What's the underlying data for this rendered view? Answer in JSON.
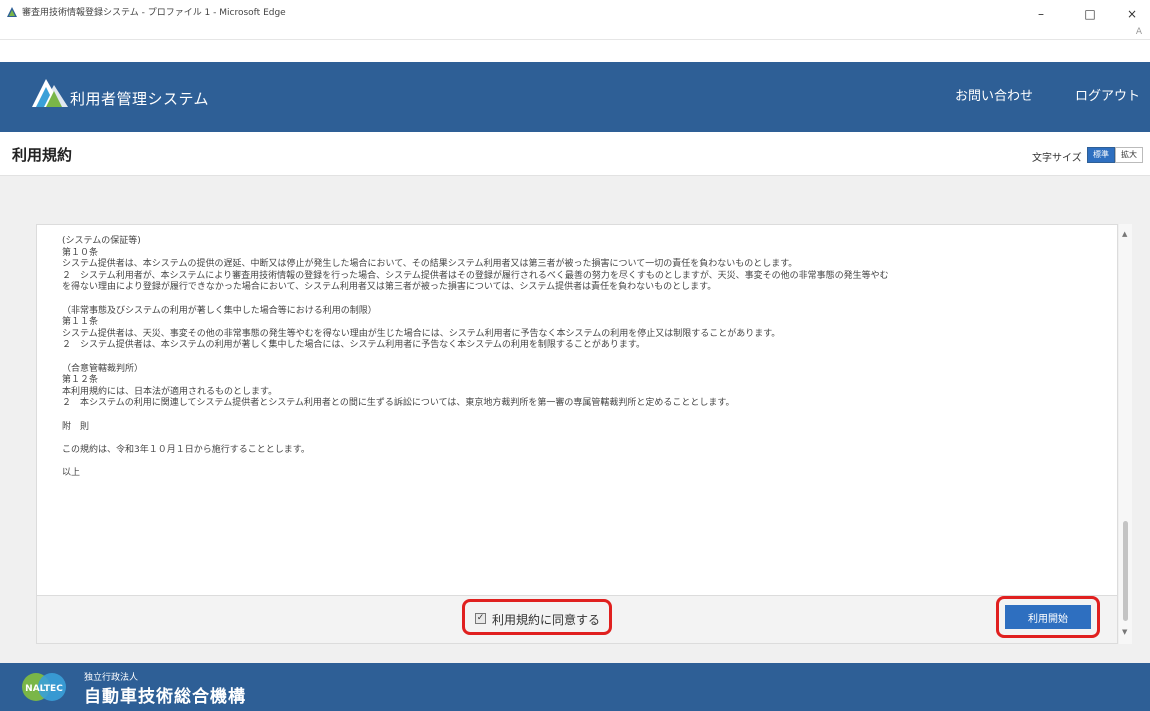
{
  "window": {
    "title": "審査用技術情報登録システム - プロファイル 1 - Microsoft Edge",
    "minimize": "–",
    "maximize": "□",
    "close": "×",
    "read_aloud": "A"
  },
  "header": {
    "app_title": "利用者管理システム",
    "contact_label": "お問い合わせ",
    "logout_label": "ログアウト"
  },
  "subheader": {
    "page_title": "利用規約",
    "font_size_label": "文字サイズ",
    "font_size_standard": "標準",
    "font_size_large": "拡大"
  },
  "terms": {
    "lines": [
      "(システムの保証等)",
      "第１０条",
      "システム提供者は、本システムの提供の遅延、中断又は停止が発生した場合において、その結果システム利用者又は第三者が被った損害について一切の責任を負わないものとします。",
      "２　システム利用者が、本システムにより審査用技術情報の登録を行った場合、システム提供者はその登録が履行されるべく最善の努力を尽くすものとしますが、天災、事変その他の非常事態の発生等やむ",
      "を得ない理由により登録が履行できなかった場合において、システム利用者又は第三者が被った損害については、システム提供者は責任を負わないものとします。",
      "",
      "（非常事態及びシステムの利用が著しく集中した場合等における利用の制限）",
      "第１１条",
      "システム提供者は、天災、事変その他の非常事態の発生等やむを得ない理由が生じた場合には、システム利用者に予告なく本システムの利用を停止又は制限することがあります。",
      "２　システム提供者は、本システムの利用が著しく集中した場合には、システム利用者に予告なく本システムの利用を制限することがあります。",
      "",
      "（合意管轄裁判所）",
      "第１２条",
      "本利用規約には、日本法が適用されるものとします。",
      "２　本システムの利用に関連してシステム提供者とシステム利用者との間に生ずる訴訟については、東京地方裁判所を第一審の専属管轄裁判所と定めることとします。",
      "",
      "附　則",
      "",
      "この規約は、令和3年１０月１日から施行することとします。",
      "",
      "以上"
    ]
  },
  "agree": {
    "checked_mark": "✓",
    "label": "利用規約に同意する",
    "start_button": "利用開始"
  },
  "footer": {
    "org_type": "独立行政法人",
    "org_name": "自動車技術総合機構",
    "logo_text": "NALTEC"
  },
  "colors": {
    "header_blue": "#2e5f96",
    "button_blue": "#2e6fc0",
    "highlight_red": "#e0201f"
  }
}
